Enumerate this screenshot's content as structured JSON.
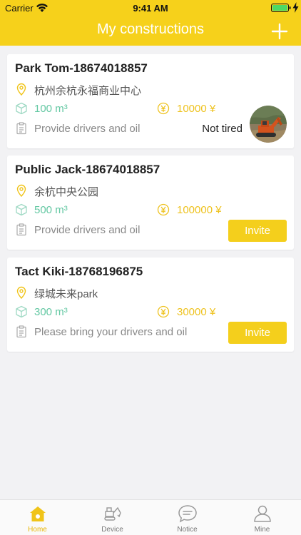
{
  "status_bar": {
    "carrier": "Carrier",
    "time": "9:41 AM"
  },
  "nav": {
    "title": "My constructions",
    "add_icon": "plus-icon"
  },
  "colors": {
    "brand": "#f6d11b",
    "volume": "#64c8a3",
    "price": "#eec21e"
  },
  "constructions": [
    {
      "title": "Park Tom-18674018857",
      "address": "杭州余杭永福商业中心",
      "volume": "100 m³",
      "price": "10000 ¥",
      "note": "Provide drivers and oil",
      "status": "Not tired"
    },
    {
      "title": "Public Jack-18674018857",
      "address": "余杭中央公园",
      "volume": "500 m³",
      "price": "100000 ¥",
      "note": "Provide drivers and oil",
      "action": "Invite"
    },
    {
      "title": "Tact Kiki-18768196875",
      "address": "绿城未来park",
      "volume": "300 m³",
      "price": "30000 ¥",
      "note": "Please bring your drivers and oil",
      "action": "Invite"
    }
  ],
  "tabbar": {
    "items": [
      {
        "label": "Home",
        "icon": "home-icon",
        "active": true
      },
      {
        "label": "Device",
        "icon": "excavator-icon",
        "active": false
      },
      {
        "label": "Notice",
        "icon": "chat-bubble-icon",
        "active": false
      },
      {
        "label": "Mine",
        "icon": "user-icon",
        "active": false
      }
    ]
  }
}
